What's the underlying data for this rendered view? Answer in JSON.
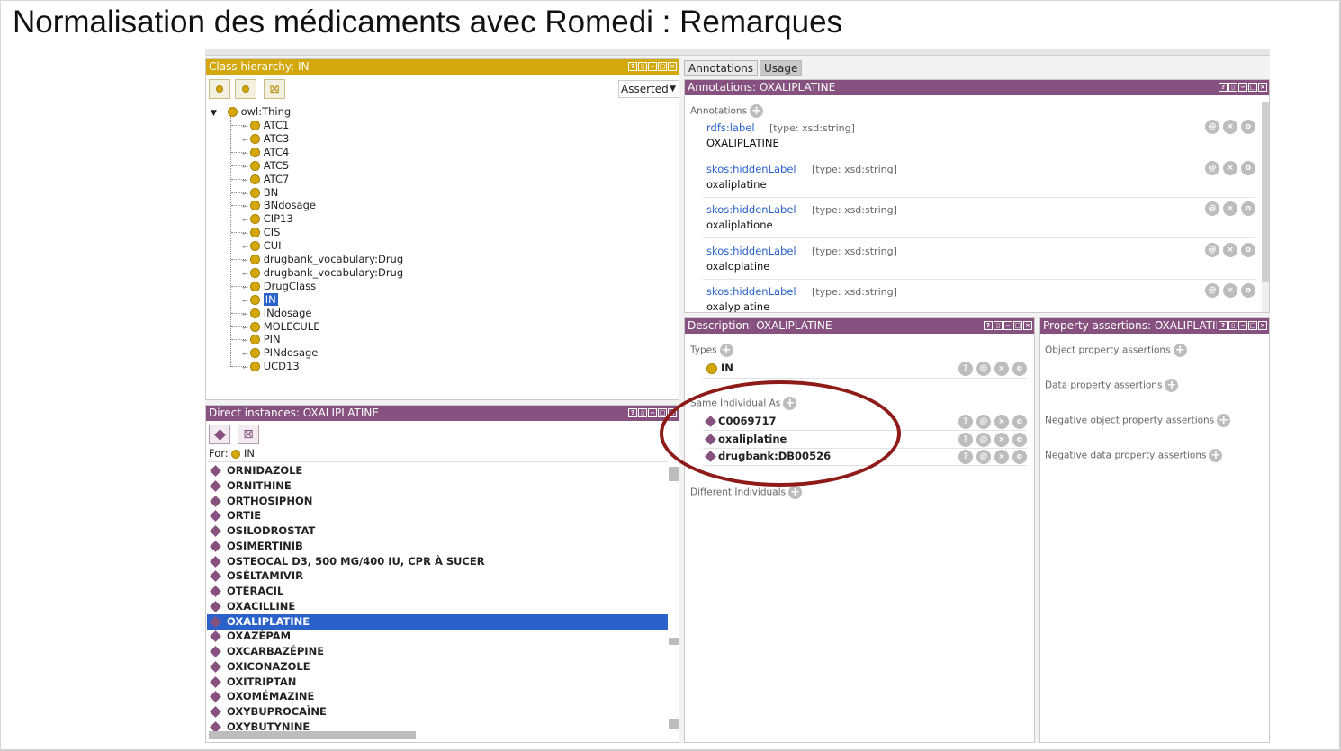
{
  "slide": {
    "title": "Normalisation des médicaments avec Romedi : Remarques"
  },
  "class_hierarchy": {
    "header": "Class hierarchy: IN",
    "mode": "Asserted",
    "root": "owl:Thing",
    "items": [
      "ATC1",
      "ATC3",
      "ATC4",
      "ATC5",
      "ATC7",
      "BN",
      "BNdosage",
      "CIP13",
      "CIS",
      "CUI",
      "drugbank_vocabulary:Drug",
      "drugbank_vocabulary:Drug",
      "DrugClass",
      "IN",
      "INdosage",
      "MOLECULE",
      "PIN",
      "PINdosage",
      "UCD13"
    ],
    "selected": "IN"
  },
  "direct_instances": {
    "header": "Direct instances: OXALIPLATINE",
    "for_label": "For:",
    "for_class": "IN",
    "items": [
      "ORNIDAZOLE",
      "ORNITHINE",
      "ORTHOSIPHON",
      "ORTIE",
      "OSILODROSTAT",
      "OSIMERTINIB",
      "OSTEOCAL D3, 500 MG/400 IU, CPR À SUCER",
      "OSÉLTAMIVIR",
      "OTÉRACIL",
      "OXACILLINE",
      "OXALIPLATINE",
      "OXAZÉPAM",
      "OXCARBAZÉPINE",
      "OXICONAZOLE",
      "OXITRIPTAN",
      "OXOMÉMAZINE",
      "OXYBUPROCAÏNE",
      "OXYBUTYNINE"
    ],
    "selected": "OXALIPLATINE"
  },
  "tabs": {
    "annotations": "Annotations",
    "usage": "Usage"
  },
  "annotations_panel": {
    "header": "Annotations: OXALIPLATINE",
    "section": "Annotations",
    "items": [
      {
        "property": "rdfs:label",
        "type": "[type: xsd:string]",
        "value": "OXALIPLATINE"
      },
      {
        "property": "skos:hiddenLabel",
        "type": "[type: xsd:string]",
        "value": "oxaliplatine"
      },
      {
        "property": "skos:hiddenLabel",
        "type": "[type: xsd:string]",
        "value": "oxaliplatione"
      },
      {
        "property": "skos:hiddenLabel",
        "type": "[type: xsd:string]",
        "value": "oxaloplatine"
      },
      {
        "property": "skos:hiddenLabel",
        "type": "[type: xsd:string]",
        "value": "oxalyplatine"
      }
    ]
  },
  "description_panel": {
    "header": "Description: OXALIPLATINE",
    "types_label": "Types",
    "type_value": "IN",
    "same_label": "Same Individual As",
    "same_items": [
      "C0069717",
      "oxaliplatine",
      "drugbank:DB00526"
    ],
    "different_label": "Different Individuals"
  },
  "property_panel": {
    "header": "Property assertions: OXALIPLATINE",
    "sections": [
      "Object property assertions",
      "Data property assertions",
      "Negative object property assertions",
      "Negative data property assertions"
    ]
  },
  "icons": {
    "plus": "+",
    "help": "?",
    "at": "@",
    "delete": "×",
    "edit": "o"
  },
  "colors": {
    "class_header": "#d4a80b",
    "individual_header": "#86517f",
    "selection": "#2b62c9",
    "highlight_ellipse": "#8e1b18"
  }
}
